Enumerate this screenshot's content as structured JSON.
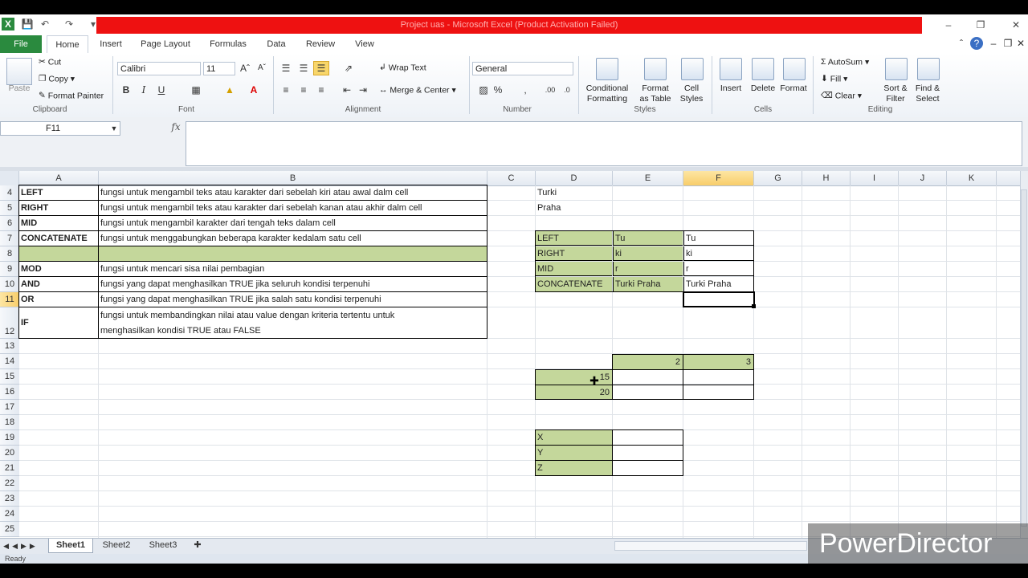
{
  "window": {
    "title": "Project uas  -  Microsoft Excel (Product Activation Failed)"
  },
  "ribbon_tabs": [
    "File",
    "Home",
    "Insert",
    "Page Layout",
    "Formulas",
    "Data",
    "Review",
    "View"
  ],
  "clipboard": {
    "paste": "Paste",
    "cut": "Cut",
    "copy": "Copy",
    "format_painter": "Format Painter",
    "label": "Clipboard"
  },
  "font": {
    "name": "Calibri",
    "size": "11",
    "label": "Font",
    "bold": "B",
    "italic": "I",
    "underline": "U"
  },
  "alignment": {
    "wrap_text": "Wrap Text",
    "merge_center": "Merge & Center",
    "label": "Alignment"
  },
  "number": {
    "format": "General",
    "label": "Number",
    "percent": "%"
  },
  "styles": {
    "conditional": "Conditional",
    "conditional2": "Formatting",
    "format_as": "Format",
    "format_as2": "as Table",
    "cell": "Cell",
    "cell2": "Styles",
    "label": "Styles"
  },
  "cells": {
    "insert": "Insert",
    "delete": "Delete",
    "format": "Format",
    "label": "Cells"
  },
  "editing": {
    "autosum": "AutoSum",
    "fill": "Fill",
    "clear": "Clear",
    "sort": "Sort &",
    "sort2": "Filter",
    "find": "Find &",
    "find2": "Select",
    "label": "Editing"
  },
  "formula_bar": {
    "name_box": "F11",
    "fx": "fx",
    "value": ""
  },
  "columns": [
    "A",
    "B",
    "C",
    "D",
    "E",
    "F",
    "G",
    "H",
    "I",
    "J",
    "K"
  ],
  "rows": [
    "4",
    "5",
    "6",
    "7",
    "8",
    "9",
    "10",
    "11",
    "12",
    "13",
    "14",
    "15",
    "16",
    "17",
    "18",
    "19",
    "20",
    "21",
    "22",
    "23",
    "24",
    "25"
  ],
  "functions": [
    {
      "name": "LEFT",
      "desc": "fungsi untuk mengambil teks atau karakter dari sebelah kiri atau awal dalm cell"
    },
    {
      "name": "RIGHT",
      "desc": "fungsi untuk mengambil teks atau karakter dari sebelah kanan atau akhir dalm cell"
    },
    {
      "name": "MID",
      "desc": "fungsi untuk mengambil karakter dari tengah teks dalam cell"
    },
    {
      "name": "CONCATENATE",
      "desc": "fungsi untuk menggabungkan  beberapa karakter kedalam satu cell"
    },
    {
      "name": "",
      "desc": ""
    },
    {
      "name": "MOD",
      "desc": "fungsi untuk mencari sisa nilai pembagian"
    },
    {
      "name": "AND",
      "desc": "fungsi yang dapat menghasilkan TRUE jika seluruh kondisi terpenuhi"
    },
    {
      "name": "OR",
      "desc": "fungsi yang dapat menghasilkan TRUE jika salah satu kondisi terpenuhi"
    }
  ],
  "if_row": {
    "name": "IF",
    "desc1": "fungsi untuk membandingkan nilai atau value dengan kriteria tertentu untuk",
    "desc2": "menghasilkan kondisi TRUE atau FALSE"
  },
  "source": {
    "d4": "Turki",
    "d5": "Praha"
  },
  "table": [
    {
      "d": "LEFT",
      "e": "Tu",
      "f": "Tu"
    },
    {
      "d": "RIGHT",
      "e": "ki",
      "f": "ki"
    },
    {
      "d": "MID",
      "e": "r",
      "f": "r"
    },
    {
      "d": "CONCATENATE",
      "e": "Turki Praha",
      "f": "Turki Praha"
    }
  ],
  "mod_table": {
    "e14": "2",
    "f14": "3",
    "d15": "15",
    "d16": "20"
  },
  "xyz": [
    "X",
    "Y",
    "Z"
  ],
  "sheets": [
    "Sheet1",
    "Sheet2",
    "Sheet3"
  ],
  "status": {
    "ready": "Ready"
  },
  "watermark": "PowerDirector"
}
